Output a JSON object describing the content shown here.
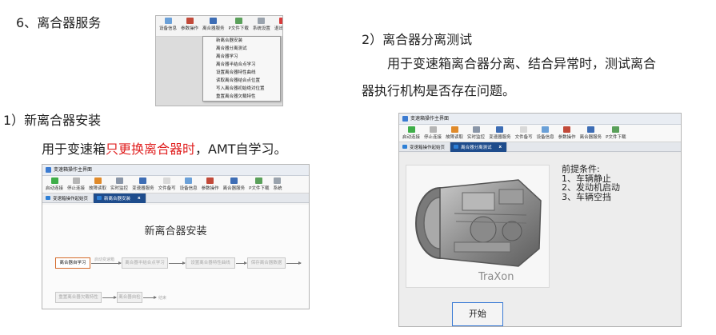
{
  "section": {
    "number": "6、",
    "title": "离合器服务"
  },
  "item1": {
    "heading": "1）新离合器安装",
    "text_pre": "用于变速箱",
    "text_red": "只更换离合器时",
    "text_post": "，AMT自学习。"
  },
  "item2": {
    "heading": "2）离合器分离测试",
    "line1": "　　用于变速箱离合器分离、结合异常时，测试离合",
    "line2": "器执行机构是否存在问题。"
  },
  "menu_screenshot": {
    "toolbar": [
      "设备信息",
      "参数操作",
      "离合器服务",
      "P文件下载",
      "系统设置",
      "退出系统"
    ],
    "menu_items": [
      "新离合器安装",
      "离合器分离测试",
      "离合器学习",
      "离合器半结合点学习",
      "设置离合器特性曲线",
      "读取离合器结合点位置",
      "写入离合器初始绝对位置",
      "重置离合器欠载特性"
    ]
  },
  "install_screenshot": {
    "title_bar": "变速箱操作主界面",
    "toolbar": [
      "启动连接",
      "停止连接",
      "故障读取",
      "实时监控",
      "变速器服务",
      "文件备写",
      "设备信息",
      "参数操作",
      "离合器服务",
      "P文件下载",
      "系统"
    ],
    "tabs": [
      "变速箱操作起始页",
      "新离合器安装"
    ],
    "close_label": "x",
    "page_title": "新离合器安装",
    "steps": [
      "离合器自学习",
      "离合器半结合点学习",
      "设置离合器特性曲线",
      "保存离合器数据",
      "重置离合器欠载特性",
      "离合器自检"
    ],
    "arrow_labels": [
      "启动变速箱"
    ],
    "end_label": "结束"
  },
  "test_screenshot": {
    "title_bar": "变速箱操作主界面",
    "toolbar": [
      "启动连接",
      "停止连接",
      "故障读取",
      "实时监控",
      "变速器服务",
      "文件备写",
      "设备信息",
      "参数操作",
      "离合器服务",
      "P文件下载"
    ],
    "tabs": [
      "变速箱操作起始页",
      "离合器分离测试"
    ],
    "close_label": "x",
    "gearbox_brand": "TraXon",
    "conditions": [
      "前提条件:",
      "1、车辆静止",
      "2、发动机启动",
      "3、车辆空挡"
    ],
    "start_button": "开始"
  }
}
